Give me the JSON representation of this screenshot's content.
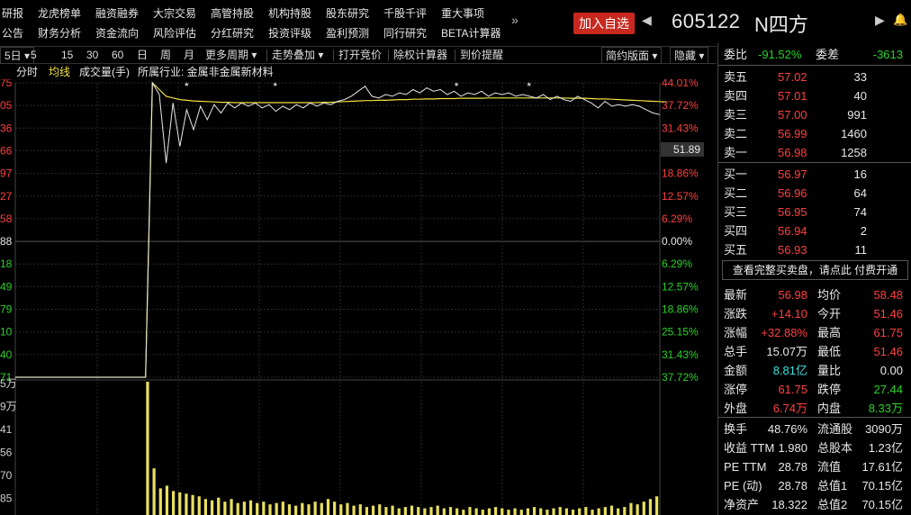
{
  "menu": {
    "row1": [
      "研报",
      "龙虎榜单",
      "融资融券",
      "大宗交易",
      "高管持股",
      "机构持股",
      "股东研究",
      "千股千评",
      "重大事项"
    ],
    "row2": [
      "公告",
      "财务分析",
      "资金流向",
      "风险评估",
      "分红研究",
      "投资评级",
      "盈利预测",
      "同行研究",
      "BETA计算器"
    ],
    "more": "»"
  },
  "header": {
    "add_fav": "加入自选",
    "code": "605122",
    "name": "N四方",
    "prev_icon": "◀",
    "next_icon": "▶",
    "bell_icon": "🔔"
  },
  "toolbar": {
    "period": "5日",
    "items": [
      "5",
      "15",
      "30",
      "60",
      "日",
      "周",
      "月"
    ],
    "more_period": "更多周期",
    "trend_overlay": "走势叠加",
    "open_auction": "打开竞价",
    "rights_calc": "除权计算器",
    "price_alert": "到价提醒",
    "simple_layout": "简约版面",
    "hide": "隐藏"
  },
  "chart_header": {
    "fenshi": "分时",
    "avg_line": "均线",
    "volume": "成交量(手)",
    "industry": "所属行业: 金属非金属新材料"
  },
  "colors": {
    "up": "#ff4040",
    "down": "#28d228",
    "price_line": "#e8e8e8",
    "avg_line": "#f0e040",
    "grid": "#2a2a2a"
  },
  "chart_data": {
    "type": "line",
    "left_price_labels": [
      "75",
      "05",
      "36",
      "66",
      "97",
      "27",
      "58",
      "88",
      "18",
      "49",
      "79",
      "10",
      "40",
      "71"
    ],
    "right_pct_labels": [
      "44.01%",
      "37.72%",
      "31.43%",
      "25.15%",
      "18.86%",
      "12.57%",
      "6.29%",
      "0.00%",
      "6.29%",
      "12.57%",
      "18.86%",
      "25.15%",
      "31.43%",
      "37.72%"
    ],
    "pct_label_signs": [
      "up",
      "up",
      "up",
      "up",
      "up",
      "up",
      "up",
      "zero",
      "down",
      "down",
      "down",
      "down",
      "down",
      "down"
    ],
    "pct_range": [
      -44.01,
      44.01
    ],
    "current_price_tag": "51.89",
    "price_series": [
      -44.01,
      -44.01,
      -44.01,
      -44.01,
      -44.01,
      -44.01,
      -44.01,
      -44.01,
      -44.01,
      -44.01,
      -44.01,
      -44.01,
      -44.01,
      -44.01,
      -44.01,
      -44.01,
      -44.01,
      -44.01,
      -44.01,
      -44.01,
      44.01,
      40.5,
      20,
      38,
      25,
      36,
      30,
      37,
      33,
      37.5,
      35,
      38,
      36.5,
      38,
      37,
      38,
      36.5,
      37.5,
      35.5,
      37,
      36,
      37.5,
      36.5,
      38,
      37,
      38,
      37.5,
      38.5,
      39,
      40,
      41.5,
      43,
      40,
      39.5,
      40.5,
      40,
      41,
      40.5,
      42,
      41,
      42.5,
      41.5,
      42,
      40.5,
      41.5,
      40,
      41,
      40.5,
      41.5,
      40,
      41,
      40.5,
      41,
      40,
      40.5,
      40,
      39.5,
      40.5,
      39,
      40,
      39,
      38.5,
      40,
      39,
      38,
      36.5,
      38.5,
      37,
      37.5,
      37,
      37.5,
      37,
      36,
      35,
      34.5
    ],
    "avg_series": [
      -44.01,
      -44.01,
      -44.01,
      -44.01,
      -44.01,
      -44.01,
      -44.01,
      -44.01,
      -44.01,
      -44.01,
      -44.01,
      -44.01,
      -44.01,
      -44.01,
      -44.01,
      -44.01,
      -44.01,
      -44.01,
      -44.01,
      -44.01,
      44.01,
      42,
      40,
      39.5,
      39,
      38.8,
      38.6,
      38.5,
      38.4,
      38.3,
      38.2,
      38.2,
      38.1,
      38.1,
      38.1,
      38.1,
      38.1,
      38.1,
      38.1,
      38.1,
      38.1,
      38.1,
      38.1,
      38.1,
      38.1,
      38.2,
      38.2,
      38.3,
      38.4,
      38.5,
      38.6,
      38.7,
      38.7,
      38.8,
      38.8,
      38.9,
      39,
      39,
      39.1,
      39.1,
      39.2,
      39.2,
      39.3,
      39.3,
      39.3,
      39.4,
      39.4,
      39.4,
      39.4,
      39.5,
      39.5,
      39.5,
      39.5,
      39.5,
      39.5,
      39.5,
      39.5,
      39.5,
      39.5,
      39.5,
      39.5,
      39.4,
      39.4,
      39.4,
      39.3,
      39.2,
      39.2,
      39.1,
      39,
      38.9,
      38.8,
      38.7,
      38.6,
      38.5,
      38.4,
      38.3
    ],
    "star_markers_at": [
      42,
      64,
      109,
      127
    ],
    "volume_labels": [
      "5万",
      "9万",
      "41",
      "56",
      "70",
      "85"
    ],
    "volume_series": [
      0,
      0,
      0,
      0,
      0,
      0,
      0,
      0,
      0,
      0,
      0,
      0,
      0,
      0,
      0,
      0,
      0,
      0,
      0,
      0,
      1.0,
      0.35,
      0.2,
      0.22,
      0.18,
      0.17,
      0.16,
      0.15,
      0.14,
      0.12,
      0.11,
      0.13,
      0.1,
      0.12,
      0.09,
      0.1,
      0.11,
      0.09,
      0.1,
      0.08,
      0.09,
      0.1,
      0.08,
      0.07,
      0.09,
      0.08,
      0.1,
      0.09,
      0.12,
      0.1,
      0.08,
      0.09,
      0.07,
      0.08,
      0.06,
      0.07,
      0.08,
      0.06,
      0.07,
      0.05,
      0.06,
      0.07,
      0.06,
      0.05,
      0.06,
      0.07,
      0.05,
      0.06,
      0.05,
      0.04,
      0.06,
      0.05,
      0.04,
      0.05,
      0.06,
      0.05,
      0.04,
      0.05,
      0.04,
      0.05,
      0.06,
      0.05,
      0.04,
      0.05,
      0.06,
      0.05,
      0.04,
      0.05,
      0.06,
      0.04,
      0.05,
      0.06,
      0.07,
      0.05,
      0.06,
      0.09,
      0.08,
      0.1,
      0.12,
      0.14
    ]
  },
  "quote": {
    "weibi_label": "委比",
    "weibi": "-91.52%",
    "weicha_label": "委差",
    "weicha": "-3613",
    "asks": [
      {
        "label": "卖五",
        "price": "57.02",
        "vol": "33"
      },
      {
        "label": "卖四",
        "price": "57.01",
        "vol": "40"
      },
      {
        "label": "卖三",
        "price": "57.00",
        "vol": "991"
      },
      {
        "label": "卖二",
        "price": "56.99",
        "vol": "1460"
      },
      {
        "label": "卖一",
        "price": "56.98",
        "vol": "1258"
      }
    ],
    "bids": [
      {
        "label": "买一",
        "price": "56.97",
        "vol": "16"
      },
      {
        "label": "买二",
        "price": "56.96",
        "vol": "64"
      },
      {
        "label": "买三",
        "price": "56.95",
        "vol": "74"
      },
      {
        "label": "买四",
        "price": "56.94",
        "vol": "2"
      },
      {
        "label": "买五",
        "price": "56.93",
        "vol": "11"
      }
    ],
    "promo": "查看完整买卖盘，请点此 付费开通",
    "stats": [
      [
        {
          "l": "最新",
          "v": "56.98",
          "c": "red"
        },
        {
          "l": "均价",
          "v": "58.48",
          "c": "red"
        }
      ],
      [
        {
          "l": "涨跌",
          "v": "+14.10",
          "c": "red"
        },
        {
          "l": "今开",
          "v": "51.46",
          "c": "red"
        }
      ],
      [
        {
          "l": "涨幅",
          "v": "+32.88%",
          "c": "red"
        },
        {
          "l": "最高",
          "v": "61.75",
          "c": "red"
        }
      ],
      [
        {
          "l": "总手",
          "v": "15.07万",
          "c": "white"
        },
        {
          "l": "最低",
          "v": "51.46",
          "c": "red"
        }
      ],
      [
        {
          "l": "金额",
          "v": "8.81亿",
          "c": "cyan"
        },
        {
          "l": "量比",
          "v": "0.00",
          "c": "white"
        }
      ],
      [
        {
          "l": "涨停",
          "v": "61.75",
          "c": "red"
        },
        {
          "l": "跌停",
          "v": "27.44",
          "c": "green"
        }
      ],
      [
        {
          "l": "外盘",
          "v": "6.74万",
          "c": "red"
        },
        {
          "l": "内盘",
          "v": "8.33万",
          "c": "green"
        }
      ]
    ],
    "stats2": [
      [
        {
          "l": "换手",
          "v": "48.76%"
        },
        {
          "l": "流通股",
          "v": "3090万"
        }
      ],
      [
        {
          "l": "收益 TTM",
          "v": "1.980"
        },
        {
          "l": "总股本",
          "v": "1.23亿"
        }
      ],
      [
        {
          "l": "PE TTM",
          "v": "28.78"
        },
        {
          "l": "流值",
          "v": "17.61亿"
        }
      ],
      [
        {
          "l": "PE (动)",
          "v": "28.78"
        },
        {
          "l": "总值1",
          "v": "70.15亿"
        }
      ],
      [
        {
          "l": "净资产",
          "v": "18.322"
        },
        {
          "l": "总值2",
          "v": "70.15亿"
        }
      ]
    ]
  }
}
